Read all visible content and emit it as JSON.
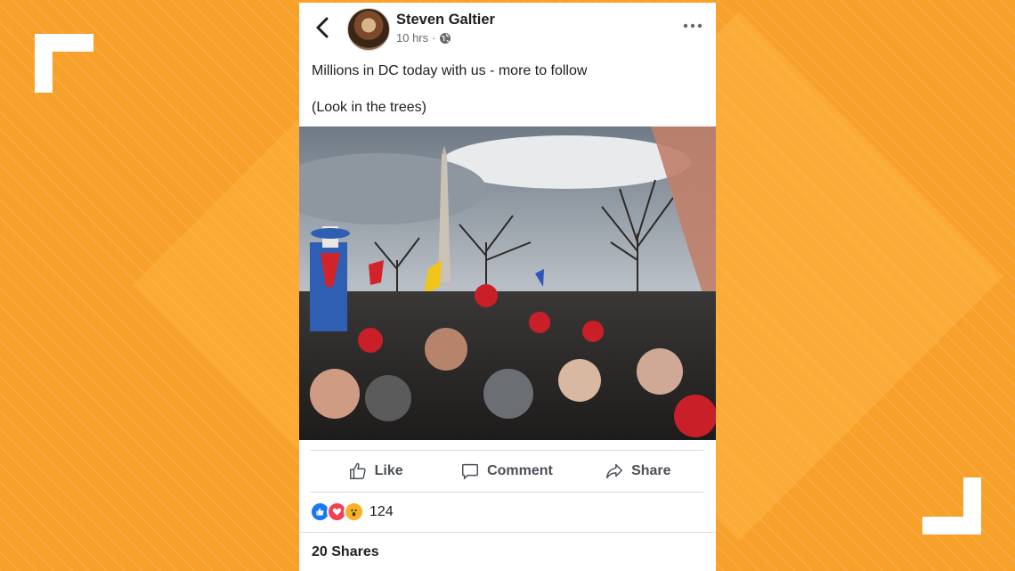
{
  "post": {
    "author": "Steven Galtier",
    "time": "10 hrs",
    "separator": "·",
    "text_line1": "Millions in DC today with us - more to follow",
    "text_line2": "(Look in the trees)"
  },
  "actions": {
    "like_label": "Like",
    "comment_label": "Comment",
    "share_label": "Share"
  },
  "stats": {
    "reaction_count": "124",
    "shares": "20 Shares"
  },
  "colors": {
    "background": "#f7a02a",
    "like_blue": "#1877f2",
    "love_red": "#f33e58",
    "wow_yellow": "#f7b125"
  },
  "icons": [
    "back-arrow-icon",
    "globe-icon",
    "more-options-icon",
    "like-thumb-icon",
    "comment-bubble-icon",
    "share-arrow-icon"
  ]
}
